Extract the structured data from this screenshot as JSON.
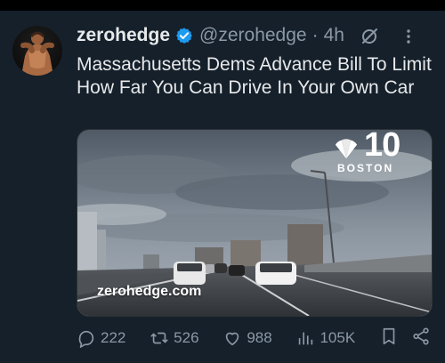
{
  "post": {
    "author_name": "zerohedge",
    "handle": "@zerohedge",
    "separator": "·",
    "time": "4h",
    "text": "Massachusetts Dems Advance Bill To Limit How Far You Can Drive In Your Own Car"
  },
  "media": {
    "channel_logo_number": "10",
    "channel_logo_city": "BOSTON",
    "watermark": "zerohedge.com"
  },
  "actions": {
    "replies": "222",
    "reposts": "526",
    "likes": "988",
    "views": "105K"
  },
  "colors": {
    "background": "#15202b",
    "verified": "#1d9bf0",
    "muted": "#8b98a5"
  }
}
